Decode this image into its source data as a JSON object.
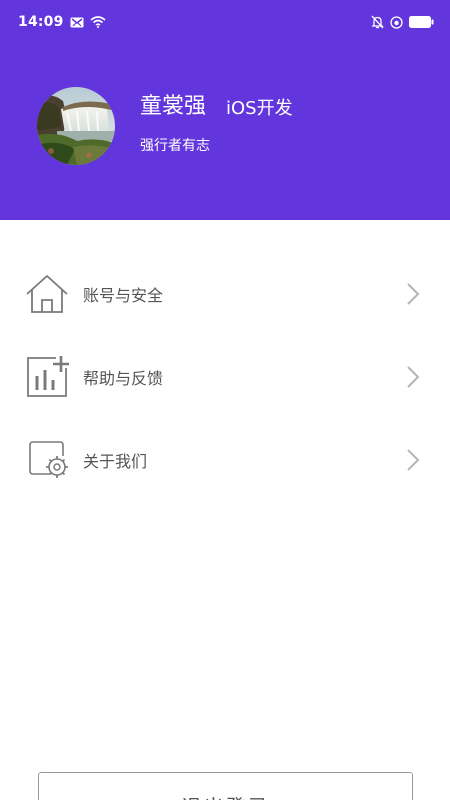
{
  "status_bar": {
    "time": "14:09",
    "icons": [
      "mail-icon",
      "wifi-icon",
      "silent-bell-icon",
      "alarm-icon",
      "battery-icon"
    ]
  },
  "profile": {
    "name": "童裳强",
    "role": "iOS开发",
    "motto": "强行者有志",
    "avatar": "waterfall-landscape"
  },
  "menu": {
    "items": [
      {
        "label": "账号与安全",
        "icon": "home-icon"
      },
      {
        "label": "帮助与反馈",
        "icon": "chart-plus-icon"
      },
      {
        "label": "关于我们",
        "icon": "settings-card-icon"
      }
    ]
  },
  "logout": {
    "label": "退出登录"
  },
  "colors": {
    "header_bg": "#6236dc",
    "text_primary": "#555555",
    "icon_gray": "#7a7a7a",
    "chevron_gray": "#b5b5b5"
  }
}
